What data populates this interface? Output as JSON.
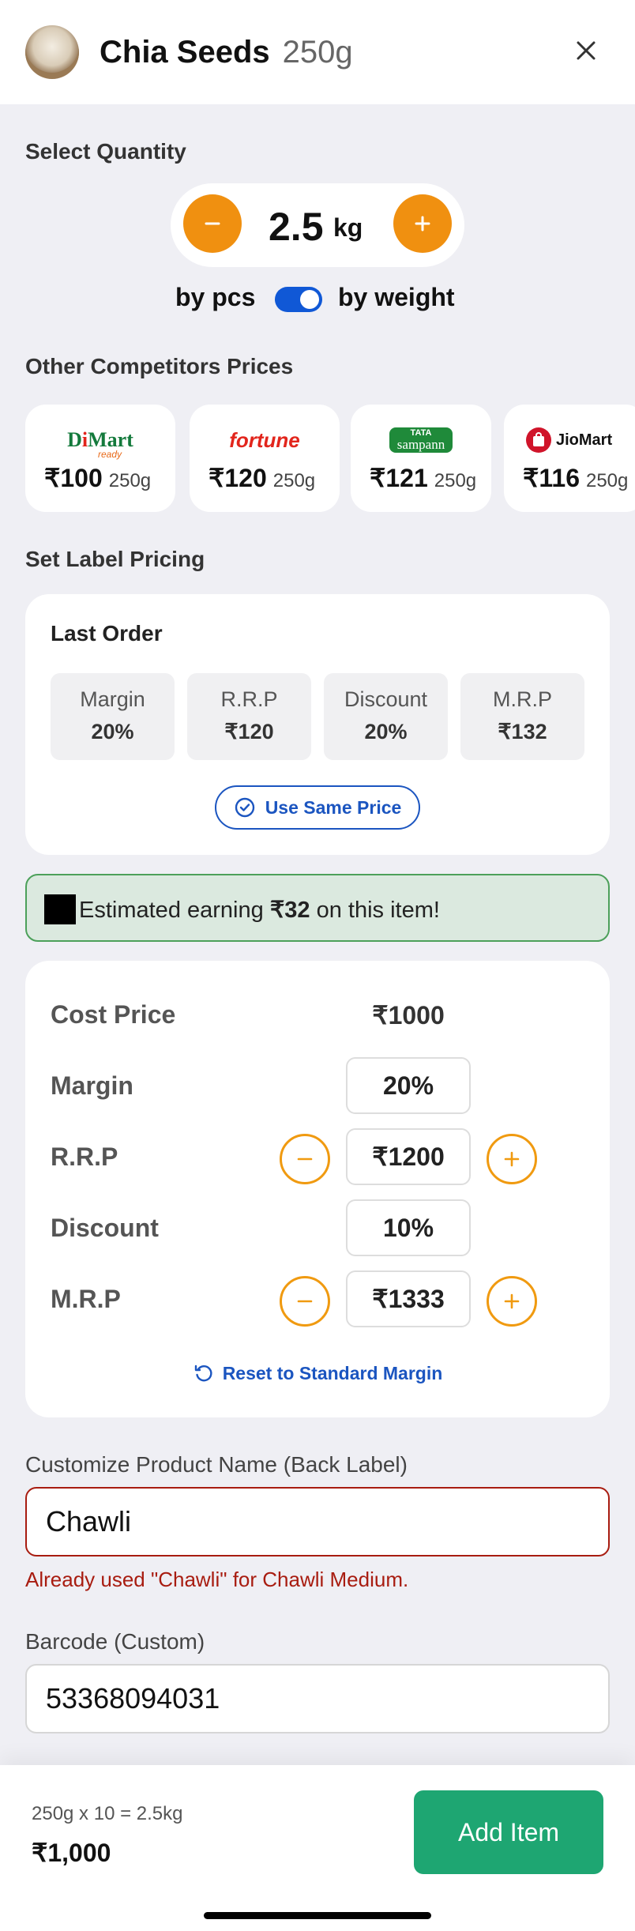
{
  "header": {
    "title": "Chia Seeds",
    "weight": "250g"
  },
  "quantity": {
    "section_label": "Select Quantity",
    "value": "2.5",
    "unit": "kg",
    "toggle_left": "by pcs",
    "toggle_right": "by weight",
    "toggle_on": true
  },
  "competitors": {
    "section_label": "Other Competitors Prices",
    "items": [
      {
        "brand": "DMart ready",
        "logo_text": "DMart",
        "logo_sub": "ready",
        "price": "₹100",
        "weight": "250g"
      },
      {
        "brand": "fortune",
        "logo_text": "fortune",
        "price": "₹120",
        "weight": "250g"
      },
      {
        "brand": "TATA sampann",
        "logo_text": "TATA",
        "logo_sub": "sampann",
        "price": "₹121",
        "weight": "250g"
      },
      {
        "brand": "JioMart",
        "logo_text": "JioMart",
        "price": "₹116",
        "weight": "250g"
      }
    ]
  },
  "label_pricing": {
    "section_label": "Set Label Pricing",
    "last_order": {
      "title": "Last Order",
      "stats": [
        {
          "label": "Margin",
          "value": "20%"
        },
        {
          "label": "R.R.P",
          "value": "₹120"
        },
        {
          "label": "Discount",
          "value": "20%"
        },
        {
          "label": "M.R.P",
          "value": "₹132"
        }
      ],
      "use_same_label": "Use Same Price"
    }
  },
  "earning": {
    "prefix": "Estimated earning ",
    "amount": "₹32",
    "suffix": " on this item!"
  },
  "pricing": {
    "cost_label": "Cost Price",
    "cost_value": "₹1000",
    "margin_label": "Margin",
    "margin_value": "20%",
    "rrp_label": "R.R.P",
    "rrp_value": "₹1200",
    "discount_label": "Discount",
    "discount_value": "10%",
    "mrp_label": "M.R.P",
    "mrp_value": "₹1333",
    "reset_label": "Reset to Standard Margin"
  },
  "customize": {
    "label": "Customize Product Name (Back Label)",
    "value": "Chawli",
    "error": "Already used \"Chawli\" for Chawli Medium."
  },
  "barcode": {
    "label": "Barcode (Custom)",
    "value": "53368094031"
  },
  "footer": {
    "calc": "250g x 10 = 2.5kg",
    "total": "₹1,000",
    "add_label": "Add Item"
  },
  "colors": {
    "accent_orange": "#f09010",
    "primary_blue": "#1058d6",
    "link_blue": "#1b55c0",
    "success_green": "#1ea672",
    "error_red": "#a81c10"
  }
}
